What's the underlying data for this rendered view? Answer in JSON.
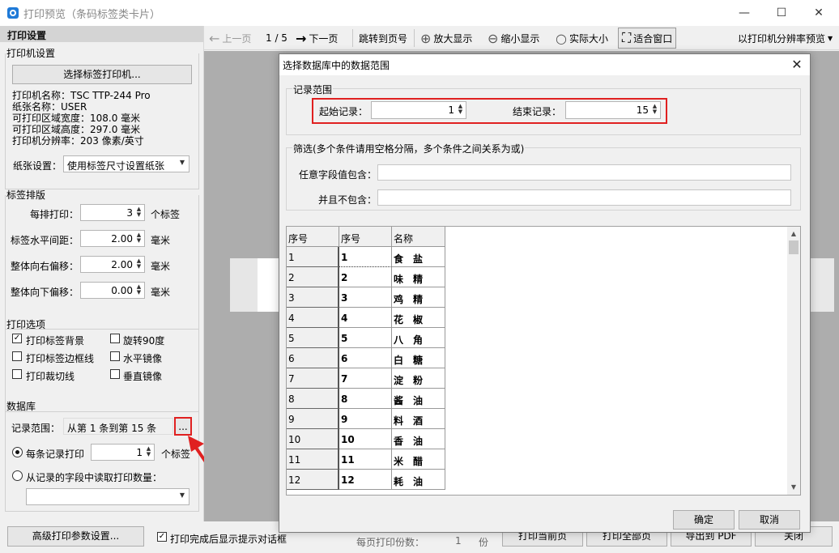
{
  "window": {
    "title": "打印预览（条码标签类卡片）",
    "minimize": "—",
    "maximize": "☐",
    "close": "✕"
  },
  "left": {
    "header": "打印设置",
    "printer": {
      "title": "打印机设置",
      "select_button": "选择标签打印机...",
      "lines": [
        "打印机名称：TSC TTP-244 Pro",
        "纸张名称：USER",
        "可打印区域宽度：108.0 毫米",
        "可打印区域高度：297.0 毫米",
        "打印机分辨率：203 像素/英寸"
      ],
      "paper_label": "纸张设置：",
      "paper_value": "使用标签尺寸设置纸张"
    },
    "layout": {
      "title": "标签排版",
      "rows": [
        {
          "label": "每排打印：",
          "value": "3",
          "unit": "个标签"
        },
        {
          "label": "标签水平间距：",
          "value": "2.00",
          "unit": "毫米"
        },
        {
          "label": "整体向右偏移：",
          "value": "2.00",
          "unit": "毫米"
        },
        {
          "label": "整体向下偏移：",
          "value": "0.00",
          "unit": "毫米"
        }
      ]
    },
    "options": {
      "title": "打印选项",
      "items": [
        {
          "label": "打印标签背景",
          "checked": "✓"
        },
        {
          "label": "旋转90度",
          "checked": ""
        },
        {
          "label": "打印标签边框线",
          "checked": ""
        },
        {
          "label": "水平镜像",
          "checked": ""
        },
        {
          "label": "打印裁切线",
          "checked": ""
        },
        {
          "label": "垂直镜像",
          "checked": ""
        }
      ]
    },
    "database": {
      "title": "数据库",
      "range_label": "记录范围：",
      "range_value": "从第 1 条到第 15 条",
      "ellipsis": "...",
      "per_record_label": "每条记录打印",
      "per_record_value": "1",
      "per_record_unit": "个标签",
      "field_count_label": "从记录的字段中读取打印数量："
    },
    "advanced_button": "高级打印参数设置..."
  },
  "toolbar": {
    "prev": "上一页",
    "page_indicator": "1 / 5",
    "next": "下一页",
    "jump": "跳转到页号",
    "zoom_in": "放大显示",
    "zoom_out": "缩小显示",
    "actual_size": "实际大小",
    "fit_window": "适合窗口",
    "resolution_preview": "以打印机分辨率预览"
  },
  "bottom": {
    "show_dialog_label": "打印完成后显示提示对话框",
    "show_dialog_checked": "✓",
    "copies_label": "每页打印份数：",
    "copies_value": "1",
    "copies_unit": "份",
    "print_current": "打印当前页",
    "print_all": "打印全部页",
    "export_pdf": "导出到 PDF",
    "close": "关闭"
  },
  "dialog": {
    "title": "选择数据库中的数据范围",
    "range_legend": "记录范围",
    "start_label": "起始记录：",
    "start_value": "1",
    "end_label": "结束记录：",
    "end_value": "15",
    "filter_legend": "筛选(多个条件请用空格分隔，多个条件之间关系为或)",
    "contains_label": "任意字段值包含：",
    "excludes_label": "并且不包含：",
    "columns": [
      "序号",
      "序号",
      "名称"
    ],
    "rows": [
      [
        "1",
        "1",
        "食　盐"
      ],
      [
        "2",
        "2",
        "味　精"
      ],
      [
        "3",
        "3",
        "鸡　精"
      ],
      [
        "4",
        "4",
        "花　椒"
      ],
      [
        "5",
        "5",
        "八　角"
      ],
      [
        "6",
        "6",
        "白　糖"
      ],
      [
        "7",
        "7",
        "淀　粉"
      ],
      [
        "8",
        "8",
        "酱　油"
      ],
      [
        "9",
        "9",
        "料　酒"
      ],
      [
        "10",
        "10",
        "香　油"
      ],
      [
        "11",
        "11",
        "米　醋"
      ],
      [
        "12",
        "12",
        "耗　油"
      ]
    ],
    "ok": "确定",
    "cancel": "取消"
  },
  "colors": {
    "highlight": "#e02020",
    "accent": "#1f7ad8"
  }
}
